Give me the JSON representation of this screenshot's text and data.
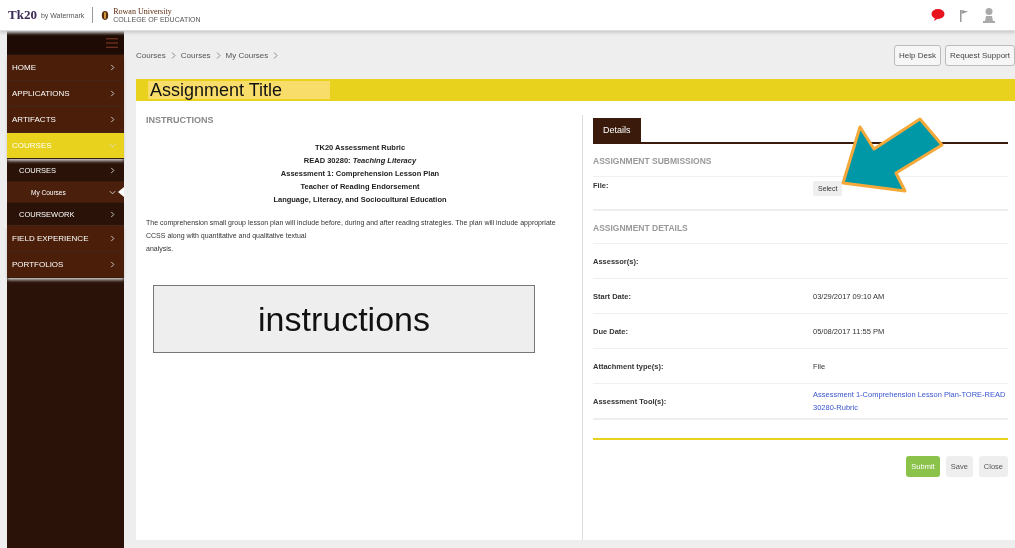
{
  "header": {
    "logo": {
      "brand": "Tk20",
      "by": "by Watermark",
      "university": "Rowan University",
      "college": "COLLEGE OF EDUCATION"
    },
    "notification": true
  },
  "sidebar": {
    "items": [
      {
        "label": "HOME",
        "kind": "top",
        "selected": false,
        "expanded": false
      },
      {
        "label": "APPLICATIONS",
        "kind": "top",
        "selected": false,
        "expanded": false
      },
      {
        "label": "ARTIFACTS",
        "kind": "top",
        "selected": false,
        "expanded": false
      },
      {
        "label": "COURSES",
        "kind": "top",
        "selected": true,
        "expanded": true
      },
      {
        "label": "COURSES",
        "kind": "sub",
        "selected": false,
        "expanded": false
      },
      {
        "label": "My Courses",
        "kind": "subsub",
        "selected": true,
        "expanded": true
      },
      {
        "label": "COURSEWORK",
        "kind": "sub",
        "selected": false,
        "expanded": false
      },
      {
        "label": "FIELD EXPERIENCE",
        "kind": "top",
        "selected": false,
        "expanded": false
      },
      {
        "label": "PORTFOLIOS",
        "kind": "top",
        "selected": false,
        "expanded": false
      }
    ]
  },
  "breadcrumb": [
    "Courses",
    "Courses",
    "My Courses"
  ],
  "top_buttons": [
    "Help Desk",
    "Request Support"
  ],
  "title": "Assignment Title",
  "instructions": {
    "heading": "INSTRUCTIONS",
    "centered_lines": [
      "TK20 Assessment Rubric",
      "READ 30280:  *Teaching Literacy*",
      "Assessment 1: Comprehension Lesson Plan",
      "Teacher of Reading Endorsement",
      "Language, Literacy, and Sociocultural Education"
    ],
    "paragraph_lines": [
      "The comprehension small group lesson plan will include before, during and after reading strategies. The plan will include appropriate CCSS along with quantitative and qualitative textual",
      "analysis."
    ],
    "callout": "instructions"
  },
  "details": {
    "tabs": [
      {
        "label": "Details",
        "selected": true
      }
    ],
    "sections": [
      {
        "heading": "ASSIGNMENT SUBMISSIONS",
        "rows": [
          {
            "label": "File:",
            "kind": "button",
            "value": "Select"
          }
        ]
      },
      {
        "heading": "ASSIGNMENT DETAILS",
        "rows": [
          {
            "label": "Assessor(s):",
            "kind": "blank"
          },
          {
            "label": "Start Date:",
            "kind": "text",
            "value": "03/29/2017 09:10 AM"
          },
          {
            "label": "Due Date:",
            "kind": "text",
            "value": "05/08/2017 11:55 PM"
          },
          {
            "label": "Attachment type(s):",
            "kind": "text",
            "value": "File"
          },
          {
            "label": "Assessment Tool(s):",
            "kind": "link",
            "value": "Assessment 1-Comprehension Lesson Plan-TORE-READ 30280-Rubric"
          }
        ]
      }
    ],
    "actions": [
      {
        "label": "Submit",
        "kind": "primary"
      },
      {
        "label": "Save",
        "kind": "plain"
      },
      {
        "label": "Close",
        "kind": "plain"
      }
    ]
  }
}
